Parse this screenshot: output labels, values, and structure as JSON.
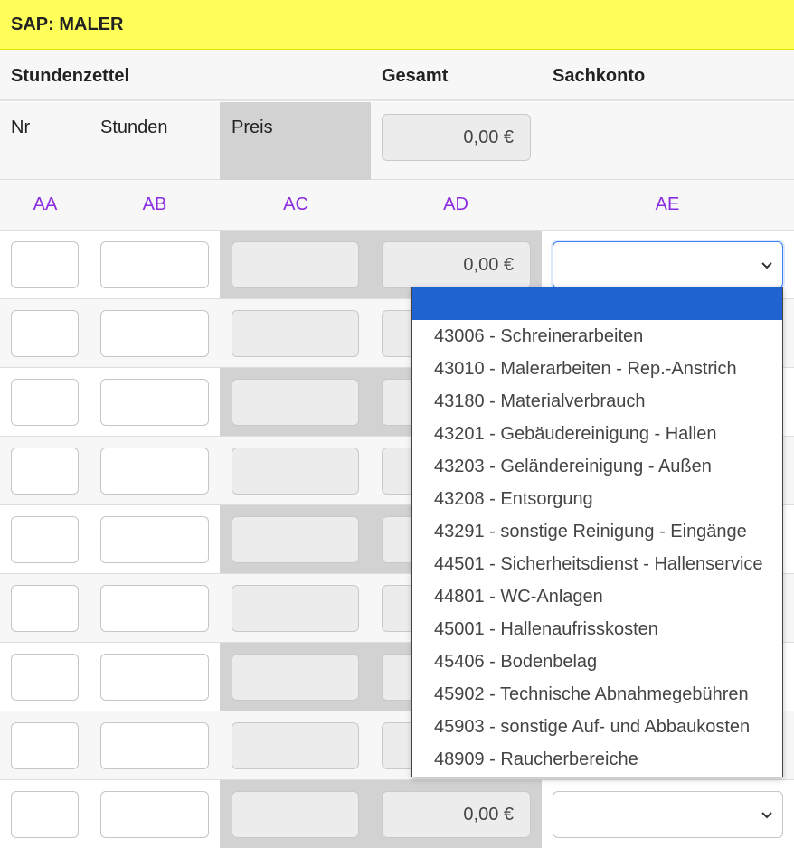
{
  "app": {
    "title": "SAP: MALER"
  },
  "section_headers": {
    "stundenzettel": "Stundenzettel",
    "gesamt": "Gesamt",
    "sachkonto": "Sachkonto"
  },
  "sub_headers": {
    "nr": "Nr",
    "stunden": "Stunden",
    "preis": "Preis",
    "total_value": "0,00 €"
  },
  "column_letters": [
    "AA",
    "AB",
    "AC",
    "AD",
    "AE"
  ],
  "rows": [
    {
      "amount": "0,00 €"
    },
    {
      "amount": ""
    },
    {
      "amount": ""
    },
    {
      "amount": ""
    },
    {
      "amount": ""
    },
    {
      "amount": ""
    },
    {
      "amount": ""
    },
    {
      "amount": ""
    },
    {
      "amount": "0,00 €"
    }
  ],
  "sachkonto_dropdown": {
    "selected": "",
    "options": [
      "43006 - Schreinerarbeiten",
      "43010 - Malerarbeiten - Rep.-Anstrich",
      "43180 - Materialverbrauch",
      "43201 - Gebäudereinigung - Hallen",
      "43203 - Geländereinigung - Außen",
      "43208 - Entsorgung",
      "43291 - sonstige Reinigung - Eingänge",
      "44501 - Sicherheitsdienst - Hallenservice",
      "44801 - WC-Anlagen",
      "45001 - Hallenaufrisskosten",
      "45406 - Bodenbelag",
      "45902 - Technische Abnahmegebühren",
      "45903 - sonstige Auf- und Abbaukosten",
      "48909 - Raucherbereiche"
    ]
  },
  "colors": {
    "title_bg": "#ffff5a",
    "column_letter": "#8a2be2",
    "highlight": "#1f63d1",
    "readonly_col": "#d2d2d2"
  },
  "icons": {
    "select_arrow": "chevron-down-icon"
  }
}
